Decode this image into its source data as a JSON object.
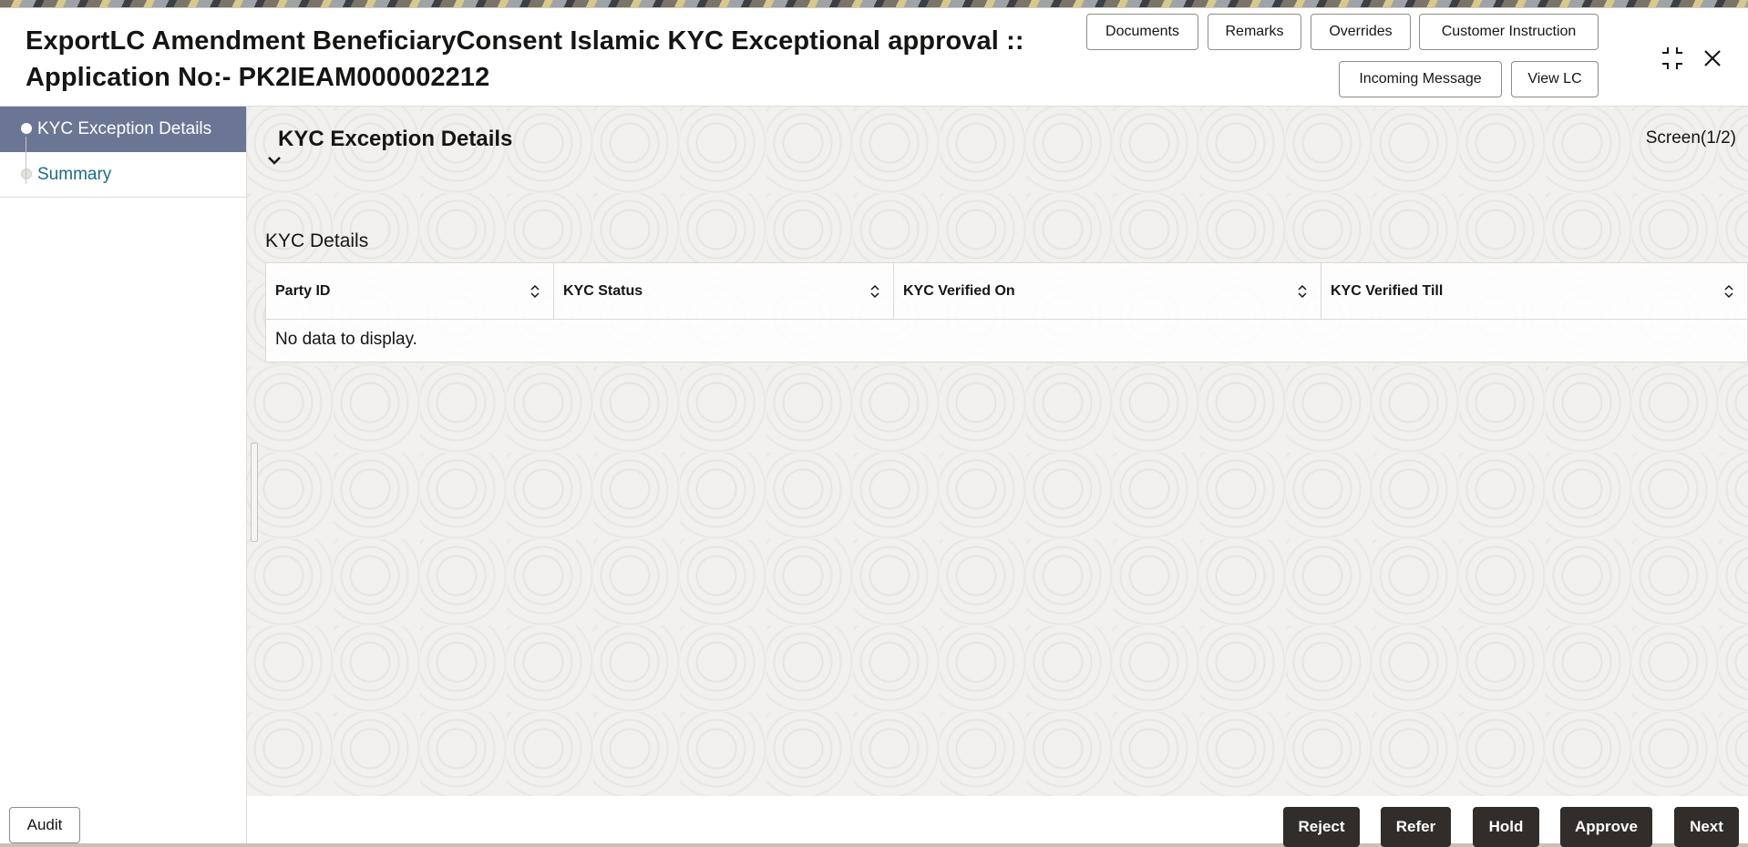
{
  "header": {
    "title_line1": "ExportLC Amendment BeneficiaryConsent Islamic KYC Exceptional approval ::",
    "title_line2": "Application No:- PK2IEAM000002212",
    "buttons": {
      "documents": "Documents",
      "remarks": "Remarks",
      "overrides": "Overrides",
      "customer_instruction": "Customer Instruction",
      "incoming_message": "Incoming Message",
      "view_lc": "View LC"
    },
    "icons": {
      "collapse": "collapse-icon",
      "close": "close-icon"
    }
  },
  "sidebar": {
    "items": [
      {
        "label": "KYC Exception Details",
        "active": true
      },
      {
        "label": "Summary",
        "active": false
      }
    ]
  },
  "main": {
    "page_title": "KYC Exception Details",
    "screen_indicator": "Screen(1/2)",
    "section_title": "KYC Details",
    "table": {
      "columns": [
        "Party ID",
        "KYC Status",
        "KYC Verified On",
        "KYC Verified Till"
      ],
      "rows": [],
      "empty_message": "No data to display."
    }
  },
  "footer": {
    "audit": "Audit",
    "reject": "Reject",
    "refer": "Refer",
    "hold": "Hold",
    "approve": "Approve",
    "next": "Next"
  },
  "colors": {
    "active_nav": "#6a7693",
    "link": "#1b6b8a",
    "primary_button": "#312d2a"
  }
}
